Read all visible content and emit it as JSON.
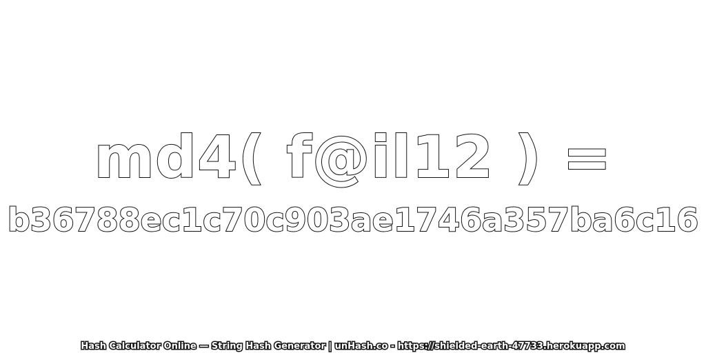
{
  "expression": "md4( f@il12 ) =",
  "hash": "b36788ec1c70c903ae1746a357ba6c16",
  "footer": "Hash Calculator Online — String Hash Generator | unHash.co - https://shielded-earth-47733.herokuapp.com",
  "colors": {
    "background": "#ffffff",
    "outline": "#111111",
    "fill": "#ffffff"
  }
}
